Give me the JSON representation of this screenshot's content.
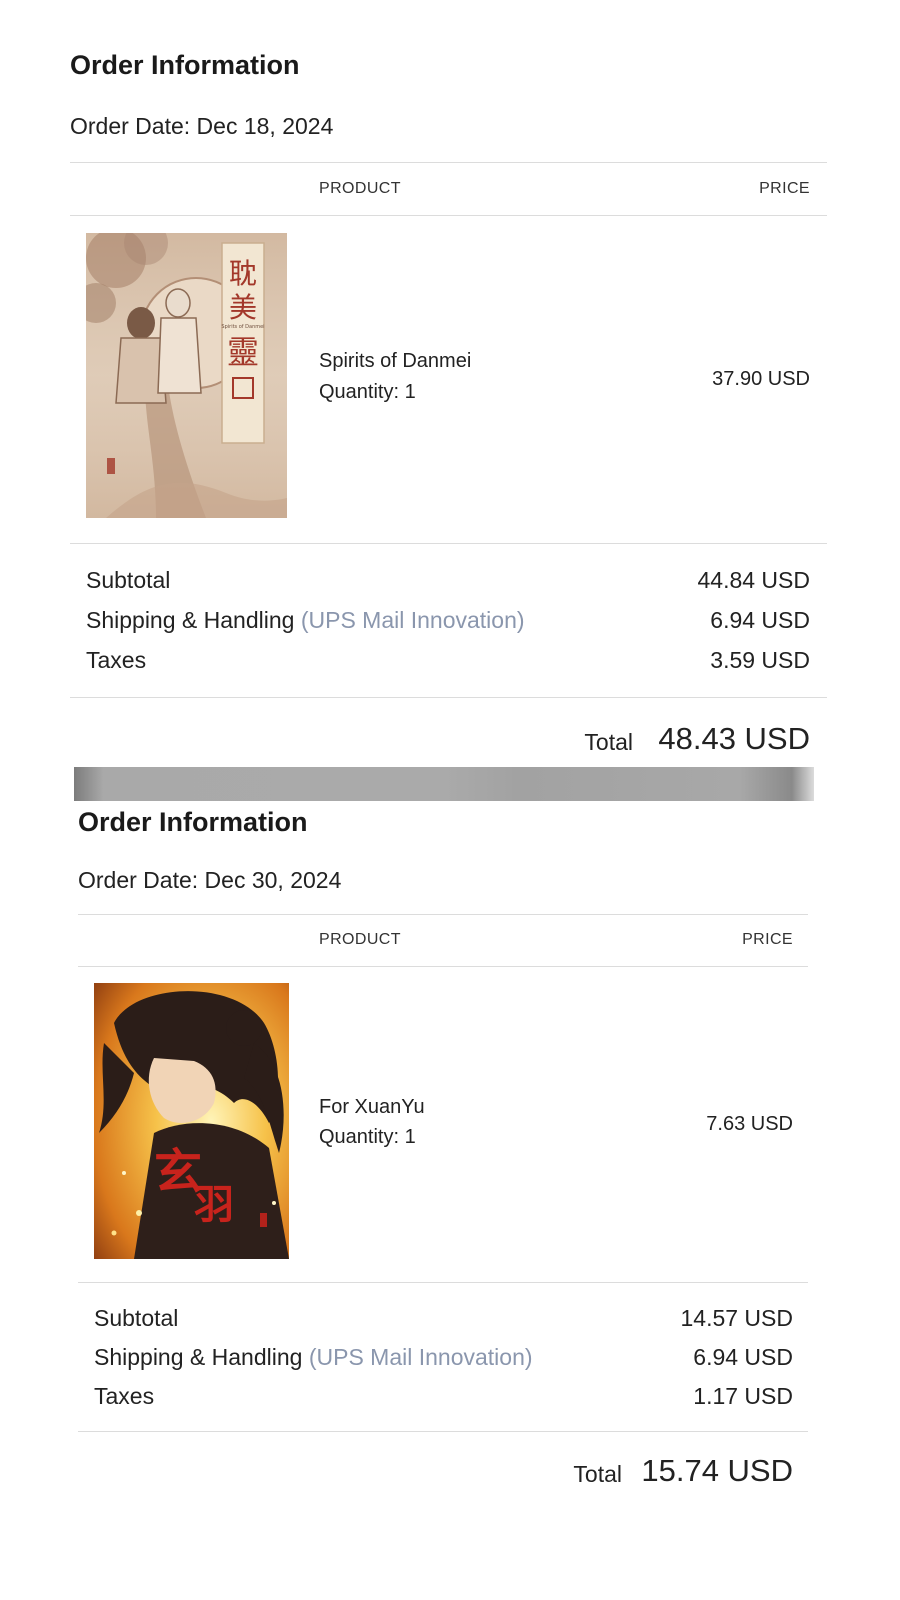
{
  "orders": [
    {
      "title": "Order Information",
      "order_date": "Order Date: Dec 18, 2024",
      "columns": {
        "product": "PRODUCT",
        "price": "PRICE"
      },
      "item": {
        "name": "Spirits of Danmei",
        "quantity": "Quantity: 1",
        "price": "37.90 USD",
        "cover_text": "耽美靈",
        "cover_subtitle": "Spirits of Danmei"
      },
      "summary": {
        "subtotal_label": "Subtotal",
        "subtotal_value": "44.84 USD",
        "shipping_label": "Shipping & Handling",
        "shipping_carrier": "(UPS Mail Innovation)",
        "shipping_value": "6.94 USD",
        "taxes_label": "Taxes",
        "taxes_value": "3.59 USD"
      },
      "total": {
        "label": "Total",
        "value": "48.43 USD"
      }
    },
    {
      "title": "Order Information",
      "order_date": "Order Date: Dec 30, 2024",
      "columns": {
        "product": "PRODUCT",
        "price": "PRICE"
      },
      "item": {
        "name": "For XuanYu",
        "quantity": "Quantity: 1",
        "price": "7.63 USD",
        "cover_text": "玄羽"
      },
      "summary": {
        "subtotal_label": "Subtotal",
        "subtotal_value": "14.57 USD",
        "shipping_label": "Shipping & Handling",
        "shipping_carrier": "(UPS Mail Innovation)",
        "shipping_value": "6.94 USD",
        "taxes_label": "Taxes",
        "taxes_value": "1.17 USD"
      },
      "total": {
        "label": "Total",
        "value": "15.74 USD"
      }
    }
  ],
  "colors": {
    "carrier_text": "#8a96ad",
    "rule": "#dcdcdc",
    "divider_bar": "#aaaaaa"
  }
}
